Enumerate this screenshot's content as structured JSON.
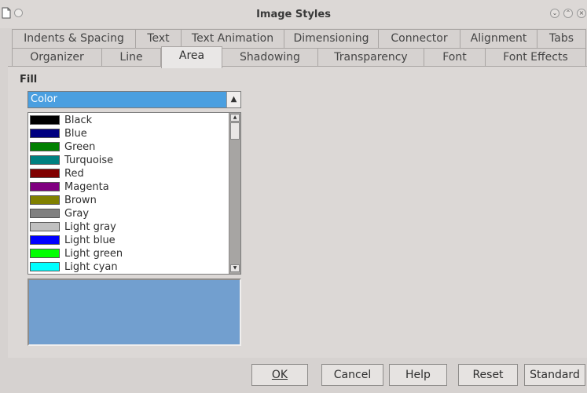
{
  "window": {
    "title": "Image Styles"
  },
  "tabs_row1": [
    {
      "label": "Indents & Spacing"
    },
    {
      "label": "Text"
    },
    {
      "label": "Text Animation"
    },
    {
      "label": "Dimensioning"
    },
    {
      "label": "Connector"
    },
    {
      "label": "Alignment"
    },
    {
      "label": "Tabs"
    }
  ],
  "tabs_row2": [
    {
      "label": "Organizer"
    },
    {
      "label": "Line"
    },
    {
      "label": "Area",
      "active": true
    },
    {
      "label": "Shadowing"
    },
    {
      "label": "Transparency"
    },
    {
      "label": "Font"
    },
    {
      "label": "Font Effects"
    }
  ],
  "fill": {
    "label": "Fill",
    "type_value": "Color",
    "colors": [
      {
        "name": "Black",
        "hex": "#000000"
      },
      {
        "name": "Blue",
        "hex": "#000080"
      },
      {
        "name": "Green",
        "hex": "#008000"
      },
      {
        "name": "Turquoise",
        "hex": "#008080"
      },
      {
        "name": "Red",
        "hex": "#800000"
      },
      {
        "name": "Magenta",
        "hex": "#800080"
      },
      {
        "name": "Brown",
        "hex": "#808000"
      },
      {
        "name": "Gray",
        "hex": "#808080"
      },
      {
        "name": "Light gray",
        "hex": "#c0c0c0"
      },
      {
        "name": "Light blue",
        "hex": "#0000ff"
      },
      {
        "name": "Light green",
        "hex": "#00ff00"
      },
      {
        "name": "Light cyan",
        "hex": "#00ffff"
      }
    ],
    "preview_color": "#729fcf"
  },
  "buttons": {
    "ok": "OK",
    "cancel": "Cancel",
    "help": "Help",
    "reset": "Reset",
    "standard": "Standard"
  }
}
